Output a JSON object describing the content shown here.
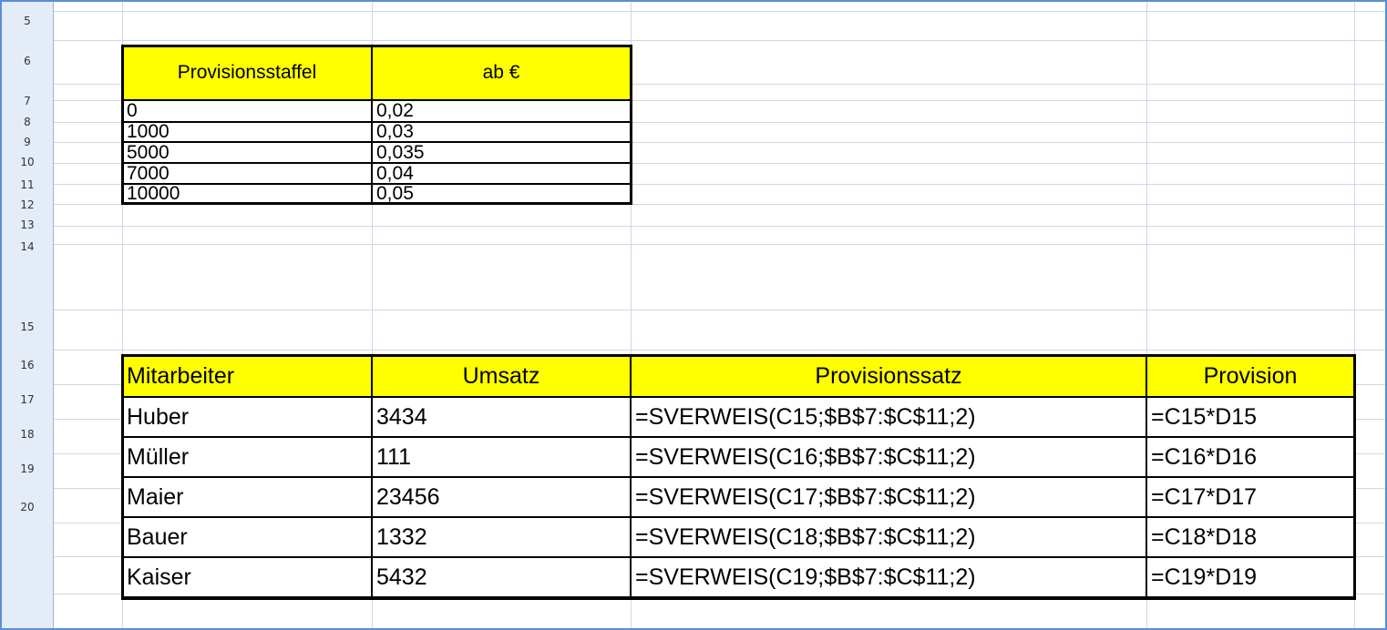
{
  "row_numbers": [
    "5",
    "6",
    "7",
    "8",
    "9",
    "10",
    "11",
    "12",
    "13",
    "14",
    "15",
    "16",
    "17",
    "18",
    "19",
    "20"
  ],
  "table1": {
    "headers": [
      "Provisionsstaffel",
      "ab €"
    ],
    "rows": [
      [
        "0",
        "0,02"
      ],
      [
        "1000",
        "0,03"
      ],
      [
        "5000",
        "0,035"
      ],
      [
        "7000",
        "0,04"
      ],
      [
        "10000",
        "0,05"
      ]
    ]
  },
  "table2": {
    "headers": [
      "Mitarbeiter",
      "Umsatz",
      "Provisionssatz",
      "Provision"
    ],
    "rows": [
      [
        "Huber",
        "3434",
        "=SVERWEIS(C15;$B$7:$C$11;2)",
        "=C15*D15"
      ],
      [
        "Müller",
        "111",
        "=SVERWEIS(C16;$B$7:$C$11;2)",
        "=C16*D16"
      ],
      [
        "Maier",
        "23456",
        "=SVERWEIS(C17;$B$7:$C$11;2)",
        "=C17*D17"
      ],
      [
        "Bauer",
        "1332",
        "=SVERWEIS(C18;$B$7:$C$11;2)",
        "=C18*D18"
      ],
      [
        "Kaiser",
        "5432",
        "=SVERWEIS(C19;$B$7:$C$11;2)",
        "=C19*D19"
      ]
    ]
  },
  "colors": {
    "header_fill": "#ffff00",
    "gridline": "#d0d7e5",
    "row_header_bg": "#e4ecf7",
    "frame": "#5b8ed6"
  }
}
